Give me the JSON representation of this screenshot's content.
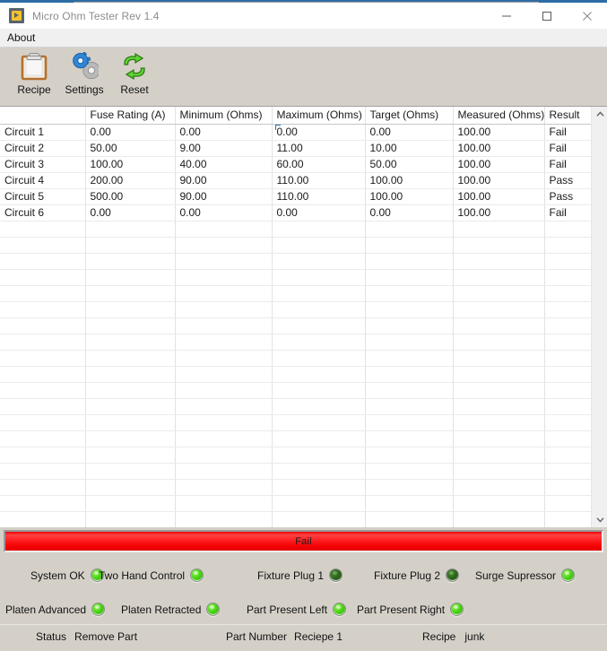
{
  "window": {
    "title": "Micro Ohm Tester Rev 1.4",
    "icon": "labview-run-icon",
    "controls": [
      {
        "name": "minimize-button",
        "glyph": "minimize-icon"
      },
      {
        "name": "maximize-button",
        "glyph": "maximize-icon"
      },
      {
        "name": "close-button",
        "glyph": "close-icon"
      }
    ],
    "accent_color": "#2e6da4"
  },
  "menubar": {
    "items": [
      {
        "label": "About",
        "name": "menu-item-about"
      }
    ]
  },
  "toolbar": {
    "buttons": [
      {
        "label": "Recipe",
        "icon": "clipboard-icon",
        "name": "toolbar-button-recipe"
      },
      {
        "label": "Settings",
        "icon": "gears-icon",
        "name": "toolbar-button-settings"
      },
      {
        "label": "Reset",
        "icon": "refresh-arrows-icon",
        "name": "toolbar-button-reset"
      }
    ]
  },
  "table": {
    "columns": [
      "",
      "Fuse Rating (A)",
      "Minimum (Ohms)",
      "Maximum (Ohms)",
      "Target (Ohms)",
      "Measured (Ohms)",
      "Result"
    ],
    "rows": [
      {
        "circuit": "Circuit 1",
        "fuse_rating_a": "0.00",
        "minimum_ohms": "0.00",
        "maximum_ohms": "0.00",
        "target_ohms": "0.00",
        "measured_ohms": "100.00",
        "result": "Fail"
      },
      {
        "circuit": "Circuit 2",
        "fuse_rating_a": "50.00",
        "minimum_ohms": "9.00",
        "maximum_ohms": "11.00",
        "target_ohms": "10.00",
        "measured_ohms": "100.00",
        "result": "Fail"
      },
      {
        "circuit": "Circuit 3",
        "fuse_rating_a": "100.00",
        "minimum_ohms": "40.00",
        "maximum_ohms": "60.00",
        "target_ohms": "50.00",
        "measured_ohms": "100.00",
        "result": "Fail"
      },
      {
        "circuit": "Circuit 4",
        "fuse_rating_a": "200.00",
        "minimum_ohms": "90.00",
        "maximum_ohms": "110.00",
        "target_ohms": "100.00",
        "measured_ohms": "100.00",
        "result": "Pass"
      },
      {
        "circuit": "Circuit 5",
        "fuse_rating_a": "500.00",
        "minimum_ohms": "90.00",
        "maximum_ohms": "110.00",
        "target_ohms": "100.00",
        "measured_ohms": "100.00",
        "result": "Pass"
      },
      {
        "circuit": "Circuit 6",
        "fuse_rating_a": "0.00",
        "minimum_ohms": "0.00",
        "maximum_ohms": "0.00",
        "target_ohms": "0.00",
        "measured_ohms": "100.00",
        "result": "Fail"
      }
    ],
    "empty_row_count": 19,
    "selected_cell": {
      "row": 0,
      "column": "maximum_ohms"
    },
    "scrollbar": {
      "up_arrow": "chevron-up-icon",
      "down_arrow": "chevron-down-icon"
    }
  },
  "banner": {
    "text": "Fail",
    "color": "#f40003"
  },
  "indicators": {
    "row1": [
      {
        "label": "System OK",
        "state": "on",
        "name": "led-system-ok"
      },
      {
        "label": "Two Hand Control",
        "state": "on",
        "name": "led-two-hand-control"
      },
      {
        "label": "Fixture Plug 1",
        "state": "off",
        "name": "led-fixture-plug-1"
      },
      {
        "label": "Fixture Plug 2",
        "state": "off",
        "name": "led-fixture-plug-2"
      },
      {
        "label": "Surge Supressor",
        "state": "on",
        "name": "led-surge-supressor"
      }
    ],
    "row2": [
      {
        "label": "Platen Advanced",
        "state": "on",
        "name": "led-platen-advanced"
      },
      {
        "label": "Platen Retracted",
        "state": "on",
        "name": "led-platen-retracted"
      },
      {
        "label": "Part Present Left",
        "state": "on",
        "name": "led-part-present-left"
      },
      {
        "label": "Part Present Right",
        "state": "on",
        "name": "led-part-present-right"
      }
    ],
    "on_color": "#2fb400",
    "off_color": "#1d4a10"
  },
  "statusbar": {
    "status_label": "Status",
    "status_value": "Remove Part",
    "part_number_label": "Part Number",
    "part_number_value": "Reciepe 1",
    "recipe_label": "Recipe",
    "recipe_value": "junk"
  }
}
